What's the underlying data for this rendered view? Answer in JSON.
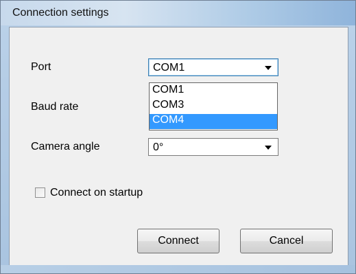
{
  "window": {
    "title": "Connection settings"
  },
  "form": {
    "port": {
      "label": "Port",
      "value": "COM1"
    },
    "baud_rate": {
      "label": "Baud rate"
    },
    "camera_angle": {
      "label": "Camera angle",
      "value": "0°"
    },
    "connect_on_startup": {
      "label": "Connect on startup",
      "checked": false
    }
  },
  "port_dropdown": {
    "options": [
      "COM1",
      "COM3",
      "COM4"
    ],
    "highlighted": "COM4"
  },
  "buttons": {
    "connect": "Connect",
    "cancel": "Cancel"
  },
  "colors": {
    "highlight": "#3399ff",
    "focus_border": "#3c7fb1"
  }
}
